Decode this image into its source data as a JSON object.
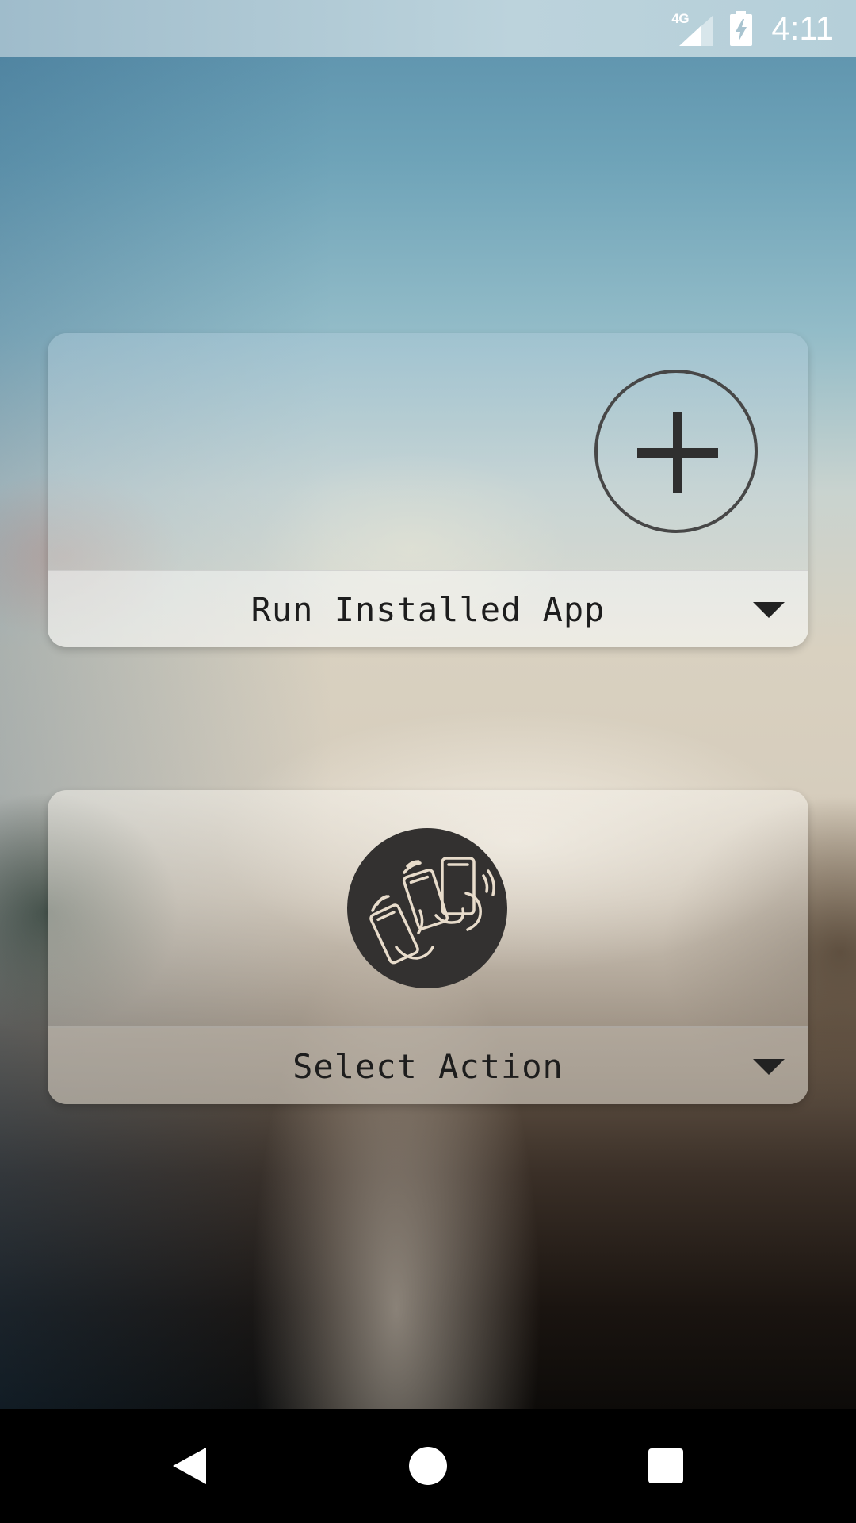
{
  "status_bar": {
    "network_label": "4G",
    "time": "4:11",
    "icons": [
      "cell-signal-icon",
      "battery-charging-icon"
    ]
  },
  "cards": [
    {
      "label": "Run Installed App",
      "icon": "add-icon"
    },
    {
      "label": "Select Action",
      "icon": "shake-phone-gesture-icon"
    }
  ],
  "nav_bar": {
    "icons": [
      "back-icon",
      "home-icon",
      "recents-icon"
    ]
  },
  "colors": {
    "card_text": "#1d1d1d",
    "gesture_icon_bg": "#333130",
    "gesture_icon_fg": "#e8dccb",
    "nav_bar_bg": "#000000"
  }
}
